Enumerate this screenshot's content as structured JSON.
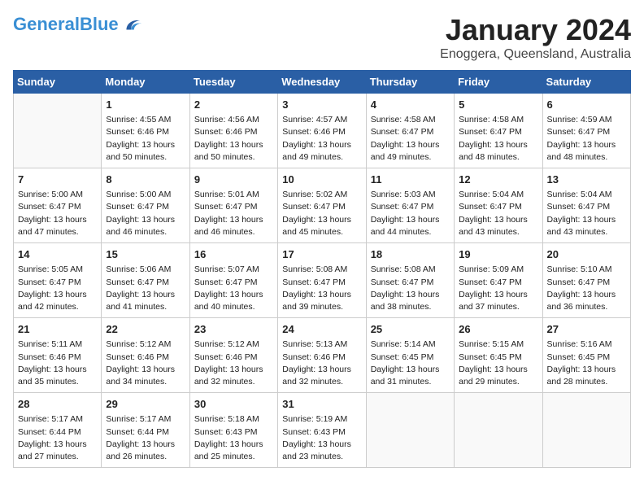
{
  "logo": {
    "text_general": "General",
    "text_blue": "Blue"
  },
  "title": "January 2024",
  "subtitle": "Enoggera, Queensland, Australia",
  "weekdays": [
    "Sunday",
    "Monday",
    "Tuesday",
    "Wednesday",
    "Thursday",
    "Friday",
    "Saturday"
  ],
  "weeks": [
    [
      {
        "day": "",
        "info": ""
      },
      {
        "day": "1",
        "info": "Sunrise: 4:55 AM\nSunset: 6:46 PM\nDaylight: 13 hours\nand 50 minutes."
      },
      {
        "day": "2",
        "info": "Sunrise: 4:56 AM\nSunset: 6:46 PM\nDaylight: 13 hours\nand 50 minutes."
      },
      {
        "day": "3",
        "info": "Sunrise: 4:57 AM\nSunset: 6:46 PM\nDaylight: 13 hours\nand 49 minutes."
      },
      {
        "day": "4",
        "info": "Sunrise: 4:58 AM\nSunset: 6:47 PM\nDaylight: 13 hours\nand 49 minutes."
      },
      {
        "day": "5",
        "info": "Sunrise: 4:58 AM\nSunset: 6:47 PM\nDaylight: 13 hours\nand 48 minutes."
      },
      {
        "day": "6",
        "info": "Sunrise: 4:59 AM\nSunset: 6:47 PM\nDaylight: 13 hours\nand 48 minutes."
      }
    ],
    [
      {
        "day": "7",
        "info": "Sunrise: 5:00 AM\nSunset: 6:47 PM\nDaylight: 13 hours\nand 47 minutes."
      },
      {
        "day": "8",
        "info": "Sunrise: 5:00 AM\nSunset: 6:47 PM\nDaylight: 13 hours\nand 46 minutes."
      },
      {
        "day": "9",
        "info": "Sunrise: 5:01 AM\nSunset: 6:47 PM\nDaylight: 13 hours\nand 46 minutes."
      },
      {
        "day": "10",
        "info": "Sunrise: 5:02 AM\nSunset: 6:47 PM\nDaylight: 13 hours\nand 45 minutes."
      },
      {
        "day": "11",
        "info": "Sunrise: 5:03 AM\nSunset: 6:47 PM\nDaylight: 13 hours\nand 44 minutes."
      },
      {
        "day": "12",
        "info": "Sunrise: 5:04 AM\nSunset: 6:47 PM\nDaylight: 13 hours\nand 43 minutes."
      },
      {
        "day": "13",
        "info": "Sunrise: 5:04 AM\nSunset: 6:47 PM\nDaylight: 13 hours\nand 43 minutes."
      }
    ],
    [
      {
        "day": "14",
        "info": "Sunrise: 5:05 AM\nSunset: 6:47 PM\nDaylight: 13 hours\nand 42 minutes."
      },
      {
        "day": "15",
        "info": "Sunrise: 5:06 AM\nSunset: 6:47 PM\nDaylight: 13 hours\nand 41 minutes."
      },
      {
        "day": "16",
        "info": "Sunrise: 5:07 AM\nSunset: 6:47 PM\nDaylight: 13 hours\nand 40 minutes."
      },
      {
        "day": "17",
        "info": "Sunrise: 5:08 AM\nSunset: 6:47 PM\nDaylight: 13 hours\nand 39 minutes."
      },
      {
        "day": "18",
        "info": "Sunrise: 5:08 AM\nSunset: 6:47 PM\nDaylight: 13 hours\nand 38 minutes."
      },
      {
        "day": "19",
        "info": "Sunrise: 5:09 AM\nSunset: 6:47 PM\nDaylight: 13 hours\nand 37 minutes."
      },
      {
        "day": "20",
        "info": "Sunrise: 5:10 AM\nSunset: 6:47 PM\nDaylight: 13 hours\nand 36 minutes."
      }
    ],
    [
      {
        "day": "21",
        "info": "Sunrise: 5:11 AM\nSunset: 6:46 PM\nDaylight: 13 hours\nand 35 minutes."
      },
      {
        "day": "22",
        "info": "Sunrise: 5:12 AM\nSunset: 6:46 PM\nDaylight: 13 hours\nand 34 minutes."
      },
      {
        "day": "23",
        "info": "Sunrise: 5:12 AM\nSunset: 6:46 PM\nDaylight: 13 hours\nand 32 minutes."
      },
      {
        "day": "24",
        "info": "Sunrise: 5:13 AM\nSunset: 6:46 PM\nDaylight: 13 hours\nand 32 minutes."
      },
      {
        "day": "25",
        "info": "Sunrise: 5:14 AM\nSunset: 6:45 PM\nDaylight: 13 hours\nand 31 minutes."
      },
      {
        "day": "26",
        "info": "Sunrise: 5:15 AM\nSunset: 6:45 PM\nDaylight: 13 hours\nand 29 minutes."
      },
      {
        "day": "27",
        "info": "Sunrise: 5:16 AM\nSunset: 6:45 PM\nDaylight: 13 hours\nand 28 minutes."
      }
    ],
    [
      {
        "day": "28",
        "info": "Sunrise: 5:17 AM\nSunset: 6:44 PM\nDaylight: 13 hours\nand 27 minutes."
      },
      {
        "day": "29",
        "info": "Sunrise: 5:17 AM\nSunset: 6:44 PM\nDaylight: 13 hours\nand 26 minutes."
      },
      {
        "day": "30",
        "info": "Sunrise: 5:18 AM\nSunset: 6:43 PM\nDaylight: 13 hours\nand 25 minutes."
      },
      {
        "day": "31",
        "info": "Sunrise: 5:19 AM\nSunset: 6:43 PM\nDaylight: 13 hours\nand 23 minutes."
      },
      {
        "day": "",
        "info": ""
      },
      {
        "day": "",
        "info": ""
      },
      {
        "day": "",
        "info": ""
      }
    ]
  ]
}
